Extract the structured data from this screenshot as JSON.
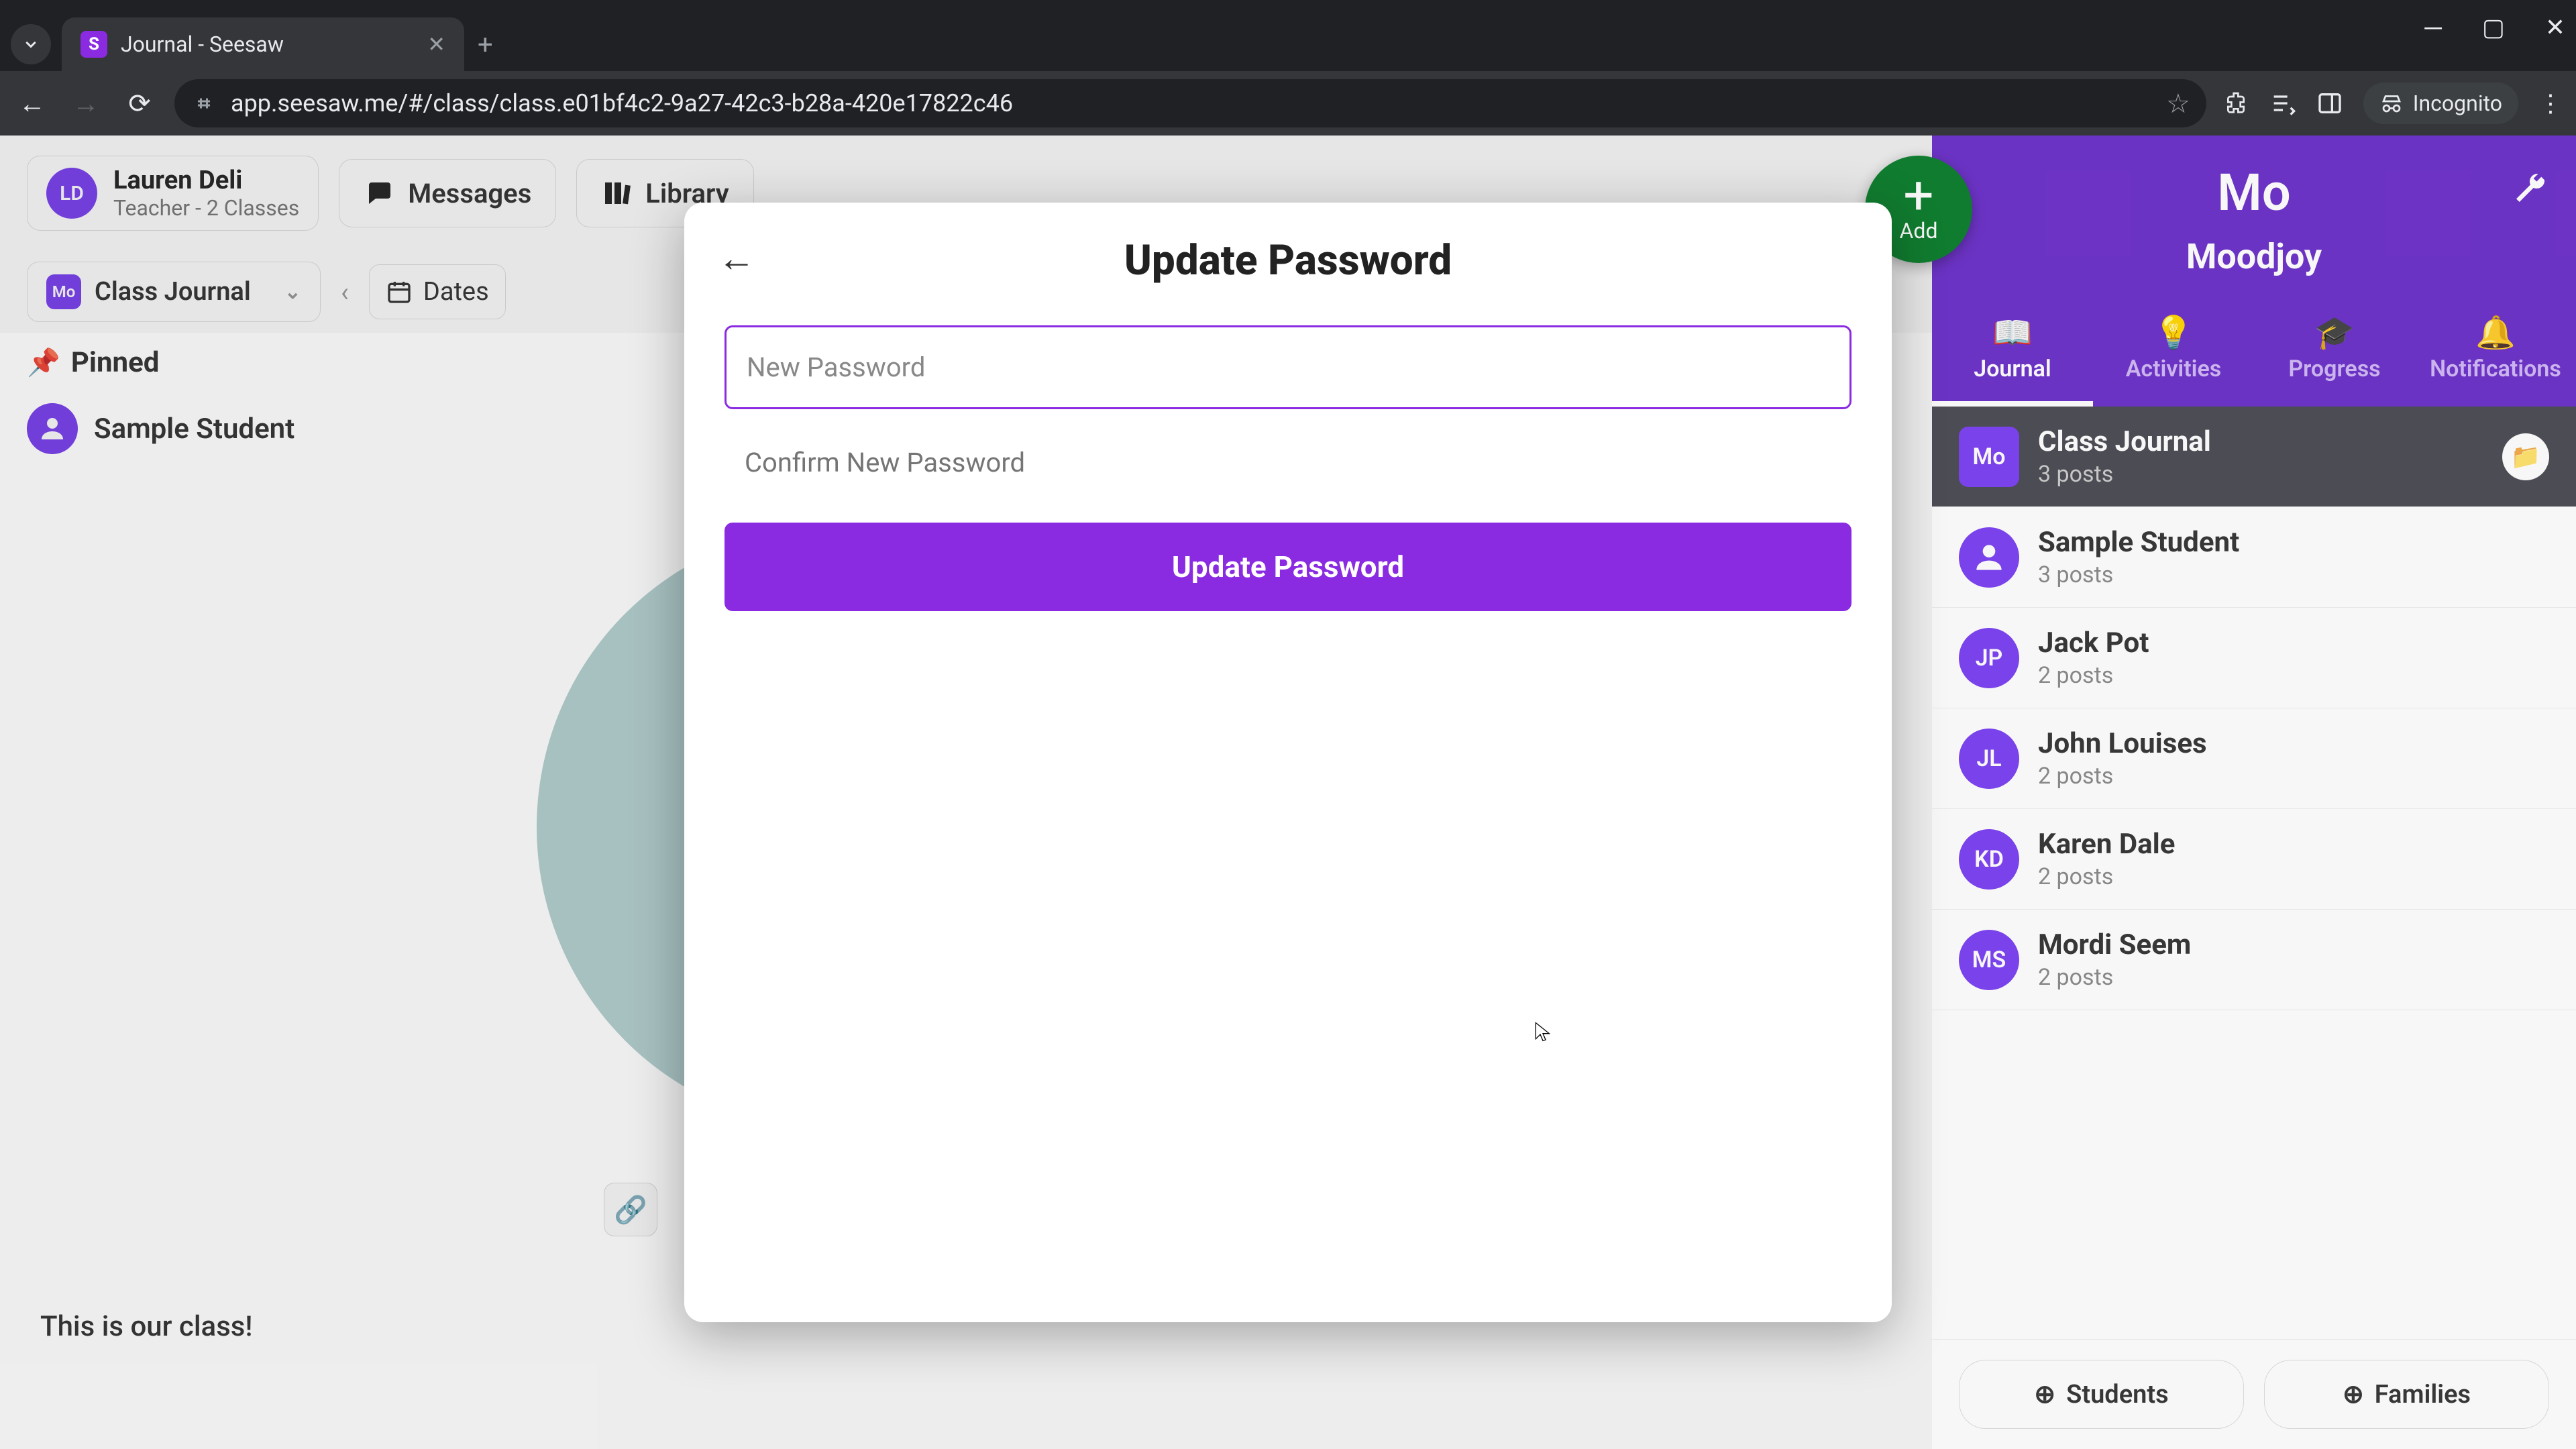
{
  "browser": {
    "tab_title": "Journal - Seesaw",
    "url": "app.seesaw.me/#/class/class.e01bf4c2-9a27-42c3-b28a-420e17822c46",
    "incognito_label": "Incognito"
  },
  "header": {
    "user_initials": "LD",
    "user_name": "Lauren Deli",
    "user_role": "Teacher - 2 Classes",
    "messages_label": "Messages",
    "library_label": "Library"
  },
  "filters": {
    "journal_badge": "Mo",
    "journal_label": "Class Journal",
    "dates_label": "Dates"
  },
  "pinned": {
    "label": "Pinned",
    "student": "Sample Student"
  },
  "post_caption": "This is our class!",
  "add_button": {
    "label": "Add"
  },
  "class_panel": {
    "badge": "Mo",
    "name": "Moodjoy",
    "tabs": {
      "journal": "Journal",
      "activities": "Activities",
      "progress": "Progress",
      "notifications": "Notifications"
    },
    "students_btn": "Students",
    "families_btn": "Families"
  },
  "student_list": [
    {
      "badge": "Mo",
      "name": "Class Journal",
      "sub": "3 posts",
      "color": "#7b3ff2",
      "active": true,
      "folder": true
    },
    {
      "badge": "",
      "name": "Sample Student",
      "sub": "3 posts",
      "color": "#7b3ff2",
      "avatar": true
    },
    {
      "badge": "JP",
      "name": "Jack Pot",
      "sub": "2 posts",
      "color": "#7b3ff2"
    },
    {
      "badge": "JL",
      "name": "John Louises",
      "sub": "2 posts",
      "color": "#7b3ff2"
    },
    {
      "badge": "KD",
      "name": "Karen Dale",
      "sub": "2 posts",
      "color": "#7b3ff2"
    },
    {
      "badge": "MS",
      "name": "Mordi Seem",
      "sub": "2 posts",
      "color": "#7b3ff2"
    }
  ],
  "modal": {
    "title": "Update Password",
    "new_pwd_placeholder": "New Password",
    "confirm_pwd_placeholder": "Confirm New Password",
    "submit_label": "Update Password"
  }
}
